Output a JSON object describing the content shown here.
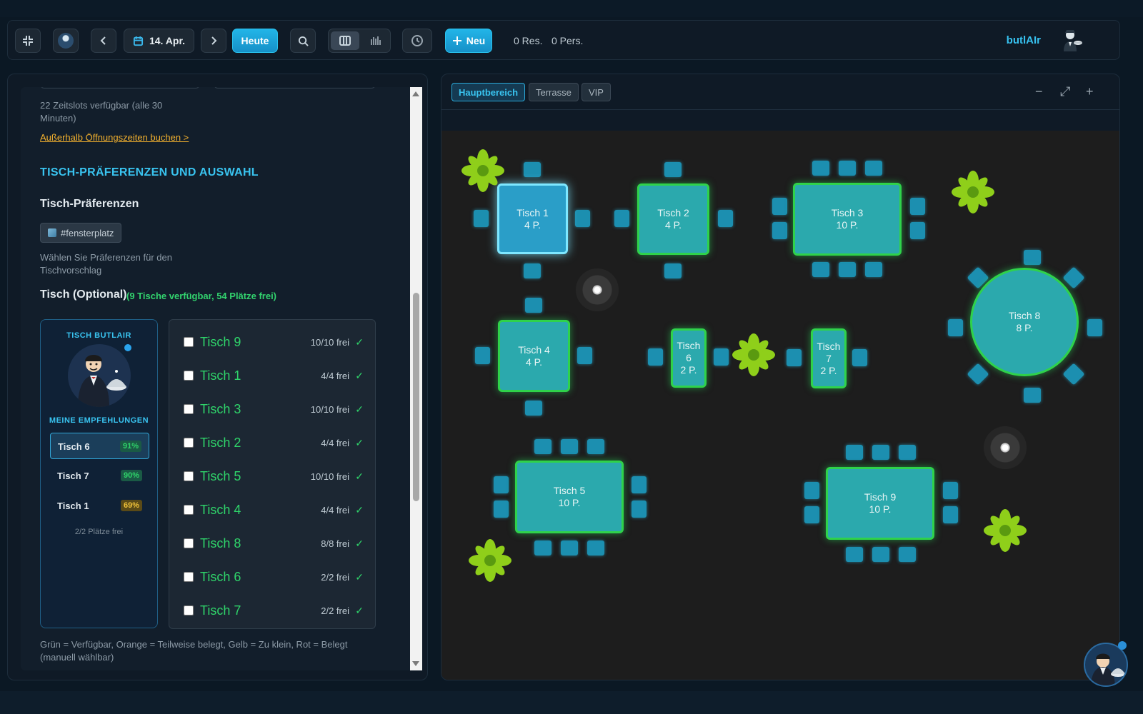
{
  "toolbar": {
    "date_label": "14. Apr.",
    "today_label": "Heute",
    "new_label": "Neu",
    "res_count": "0 Res.",
    "pers_count": "0 Pers.",
    "brand": "butlAIr"
  },
  "left": {
    "slots_info": "22 Zeitslots verfügbar (alle 30 Minuten)",
    "outside_hours_link": "Außerhalb Öffnungszeiten buchen >",
    "section_title": "TISCH-PRÄFERENZEN UND AUSWAHL",
    "prefs_title": "Tisch-Präferenzen",
    "pref_chip": "#fensterplatz",
    "prefs_hint": "Wählen Sie Präferenzen für den Tischvorschlag",
    "table_title": "Tisch (Optional)",
    "table_count": "(9 Tische verfügbar, 54 Plätze frei)",
    "butlair": {
      "title": "TISCH BUTLAIR",
      "recs_title": "MEINE EMPFEHLUNGEN",
      "recommendations": [
        {
          "label": "Tisch 6",
          "pct": "91%",
          "color": "#2fd46a"
        },
        {
          "label": "Tisch 7",
          "pct": "90%",
          "color": "#2fd46a"
        },
        {
          "label": "Tisch 1",
          "pct": "69%",
          "color": "#f0c23a"
        }
      ],
      "footer": "2/2 Plätze frei"
    },
    "tables": [
      {
        "name": "Tisch 9",
        "free": "10/10 frei"
      },
      {
        "name": "Tisch 1",
        "free": "4/4 frei"
      },
      {
        "name": "Tisch 3",
        "free": "10/10 frei"
      },
      {
        "name": "Tisch 2",
        "free": "4/4 frei"
      },
      {
        "name": "Tisch 5",
        "free": "10/10 frei"
      },
      {
        "name": "Tisch 4",
        "free": "4/4 frei"
      },
      {
        "name": "Tisch 8",
        "free": "8/8 frei"
      },
      {
        "name": "Tisch 6",
        "free": "2/2 frei"
      },
      {
        "name": "Tisch 7",
        "free": "2/2 frei"
      }
    ],
    "check_glyph": "✓",
    "legend": "Grün = Verfügbar, Orange = Teilweise belegt, Gelb = Zu klein, Rot = Belegt (manuell wählbar)"
  },
  "floorplan": {
    "areas": [
      "Hauptbereich",
      "Terrasse",
      "VIP"
    ],
    "zoom_out": "−",
    "fullscreen": "⤢",
    "zoom_in": "+",
    "tables": {
      "t1": {
        "name": "Tisch 1",
        "seats": "4 P."
      },
      "t2": {
        "name": "Tisch 2",
        "seats": "4 P."
      },
      "t3": {
        "name": "Tisch 3",
        "seats": "10 P."
      },
      "t4": {
        "name": "Tisch 4",
        "seats": "4 P."
      },
      "t5": {
        "name": "Tisch 5",
        "seats": "10 P."
      },
      "t6": {
        "name": "Tisch 6",
        "seats": "2 P."
      },
      "t7": {
        "name": "Tisch 7",
        "seats": "2 P."
      },
      "t8": {
        "name": "Tisch 8",
        "seats": "8 P."
      },
      "t9": {
        "name": "Tisch 9",
        "seats": "10 P."
      }
    }
  },
  "colors": {
    "accent": "#22b5e8",
    "available": "#2fd46a",
    "warning": "#f3b12e"
  }
}
